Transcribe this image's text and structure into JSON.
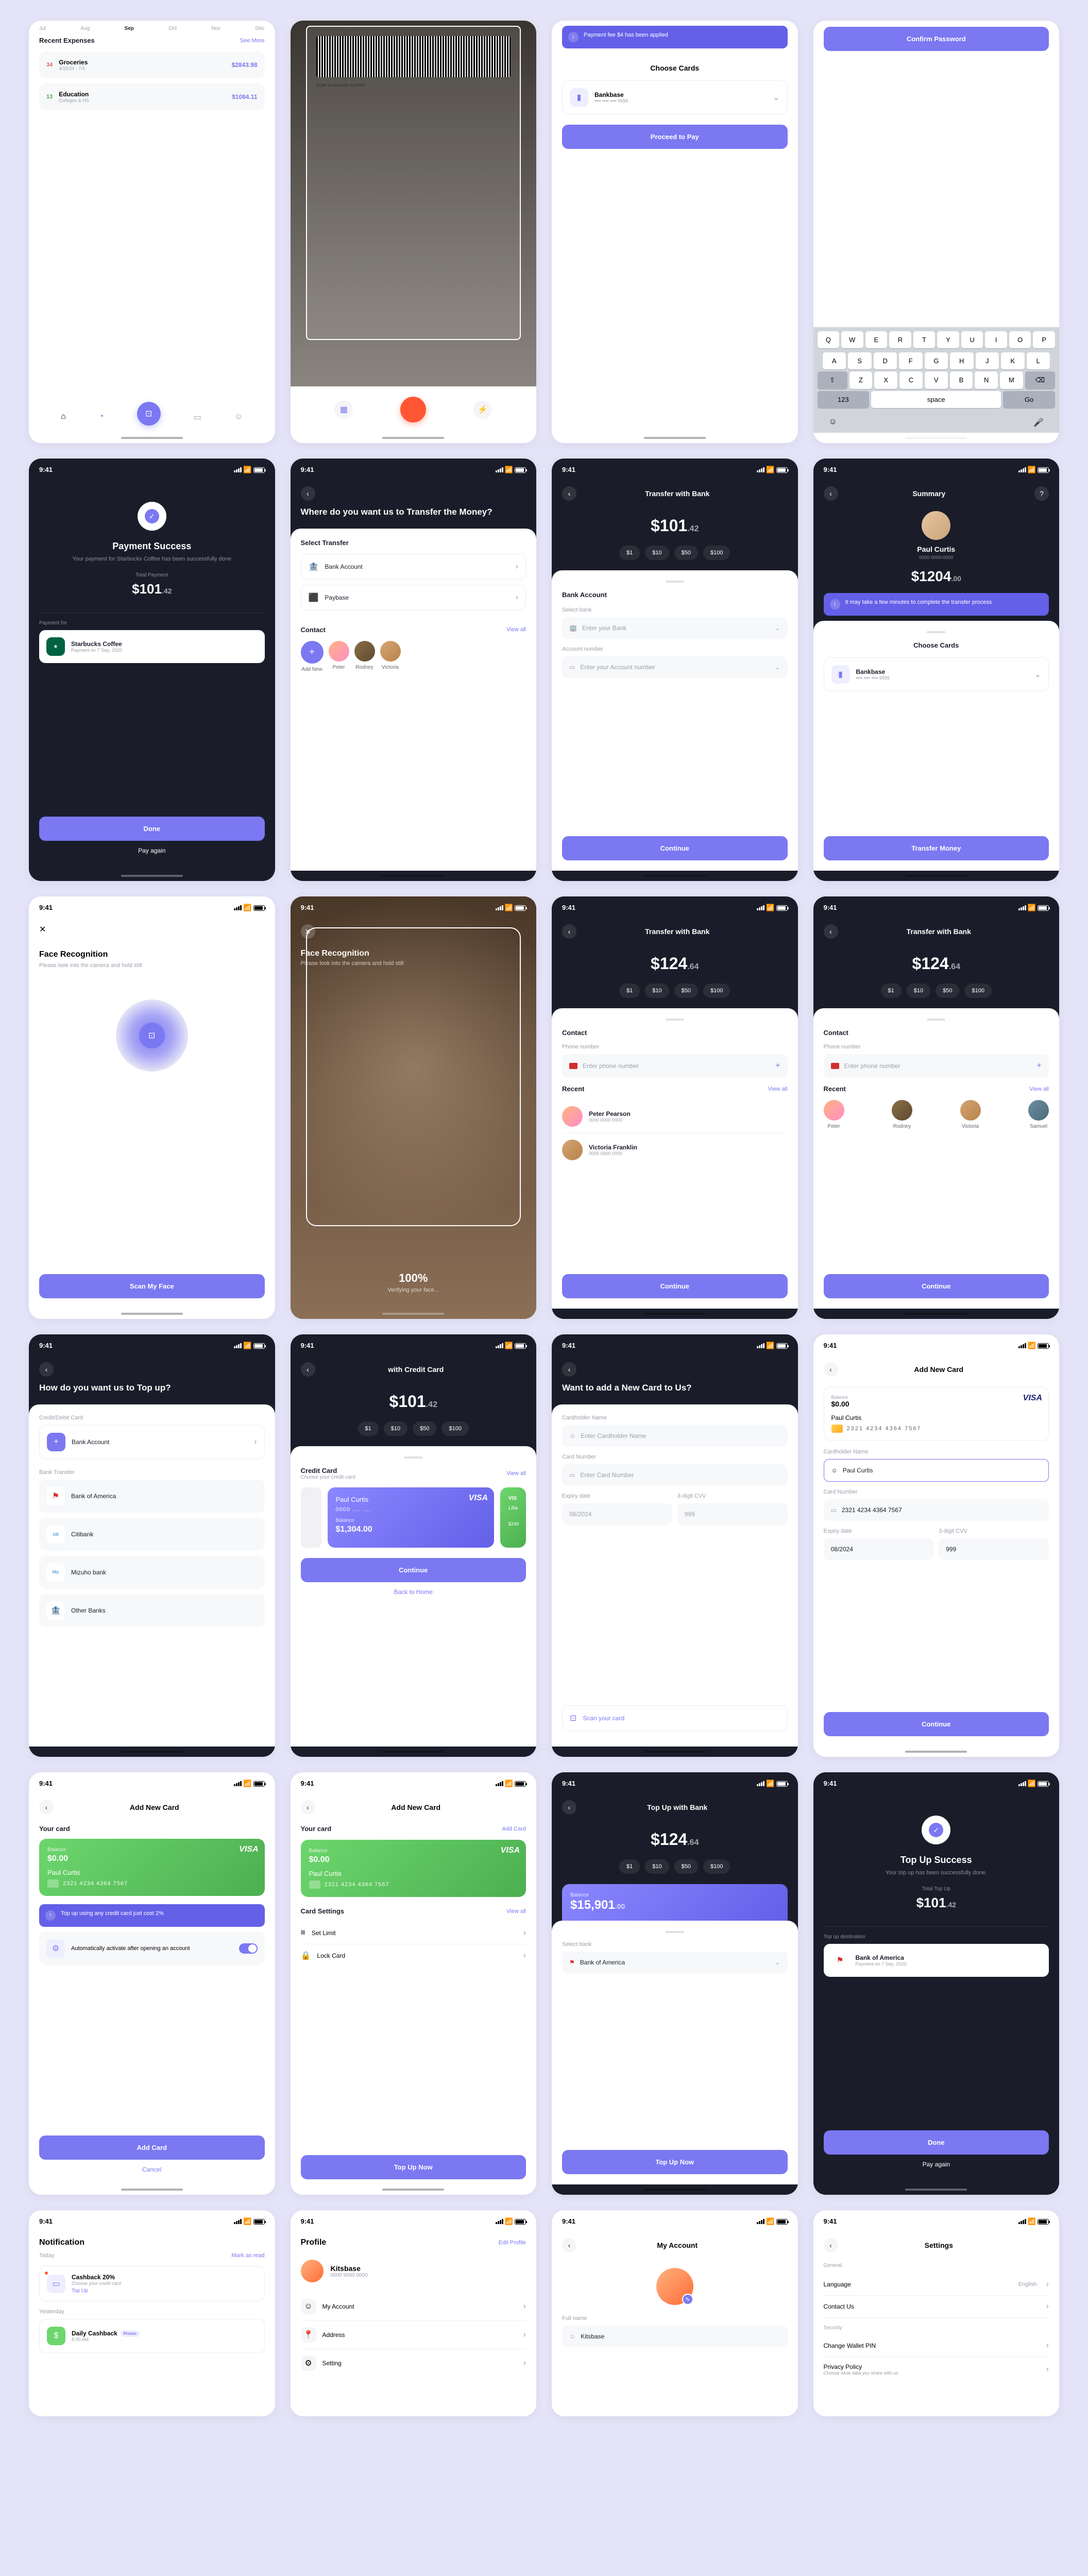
{
  "statusTime": "9:41",
  "r0": {
    "s1": {
      "months": [
        "Jul",
        "Aug",
        "Sep",
        "Oct",
        "Nov",
        "Dec"
      ],
      "section": "Recent Expenses",
      "link": "See More",
      "items": [
        {
          "day": "34",
          "name": "Groceries",
          "sub": "4/15/24 - 7/4",
          "amt": "$2843.98"
        },
        {
          "day": "13",
          "name": "Education",
          "sub": "Colleges & HS",
          "amt": "$1084.11"
        }
      ]
    },
    "s2": {
      "scanLabel": "Scan a barcode number"
    },
    "s3": {
      "notice": "Payment fee $4 has been applied",
      "title": "Choose Cards",
      "bank": "Bankbase",
      "bankNum": "•••• •••• •••• 9999",
      "btn": "Proceed to Pay"
    },
    "s4": {
      "btn": "Confirm Password",
      "keys1": [
        "Q",
        "W",
        "E",
        "R",
        "T",
        "Y",
        "U",
        "I",
        "O",
        "P"
      ],
      "keys2": [
        "A",
        "S",
        "D",
        "F",
        "G",
        "H",
        "J",
        "K",
        "L"
      ],
      "keys3": [
        "Z",
        "X",
        "C",
        "V",
        "B",
        "N",
        "M"
      ],
      "num": "123",
      "space": "space",
      "go": "Go"
    }
  },
  "r1": {
    "s1": {
      "title": "Payment Success",
      "sub": "Your payment for Starbucks Coffee has been successfully done",
      "tpLabel": "Total Payment",
      "amt": "$101",
      "amtDec": ".42",
      "pf": "Payment for",
      "merchant": "Starbucks Coffee",
      "merchSub": "Payment on 7 Sep, 2020",
      "done": "Done",
      "again": "Pay again"
    },
    "s2": {
      "title": "Where do you want us to Transfer the Money?",
      "sel": "Select Transfer",
      "opt1": "Bank Account",
      "opt2": "Paybase",
      "contactH": "Contact",
      "viewAll": "View all",
      "add": "Add New",
      "c1": "Peter",
      "c2": "Rodney",
      "c3": "Victoria"
    },
    "s3": {
      "title": "Transfer with Bank",
      "amt": "$101",
      "dec": ".42",
      "chips": [
        "$1",
        "$10",
        "$50",
        "$100"
      ],
      "sec": "Bank Account",
      "f1": "Select bank",
      "p1": "Enter your Bank",
      "f2": "Account number",
      "p2": "Enter your Account number",
      "btn": "Continue"
    },
    "s4": {
      "title": "Summary",
      "name": "Paul Curtis",
      "sub": "0000-0000-0000",
      "amt": "$1204",
      "dec": ".00",
      "notice": "It may take a few minutes to complete the transfer process",
      "choose": "Choose Cards",
      "bank": "Bankbase",
      "bankNum": "•••• •••• •••• 9999",
      "btn": "Transfer Money"
    }
  },
  "r2": {
    "s1": {
      "title": "Face Recognition",
      "sub": "Please look into the camera and hold still",
      "btn": "Scan My Face"
    },
    "s2": {
      "title": "Face Recognition",
      "sub": "Please look into the camera and hold still",
      "pct": "100%",
      "verifying": "Verifying your face..."
    },
    "s3": {
      "title": "Transfer with Bank",
      "amt": "$124",
      "dec": ".64",
      "chips": [
        "$1",
        "$10",
        "$50",
        "$100"
      ],
      "sec": "Contact",
      "f1": "Phone number",
      "p1": "Enter phone number",
      "recent": "Recent",
      "viewAll": "View all",
      "c1": "Peter Pearson",
      "c1s": "0000 0000 0000",
      "c2": "Victoria Franklin",
      "c2s": "0000 0000 0000",
      "btn": "Continue"
    },
    "s4": {
      "title": "Transfer with Bank",
      "amt": "$124",
      "dec": ".64",
      "chips": [
        "$1",
        "$10",
        "$50",
        "$100"
      ],
      "sec": "Contact",
      "f1": "Phone number",
      "p1": "Enter phone number",
      "recent": "Recent",
      "viewAll": "View all",
      "c1": "Peter",
      "c2": "Rodney",
      "c3": "Victoria",
      "c4": "Samuel",
      "btn": "Continue"
    }
  },
  "r3": {
    "s1": {
      "title": "How do you want us to Top up?",
      "cat1": "Credit/Debit Card",
      "opt1": "Bank Account",
      "cat2": "Bank Transfer",
      "b1": "Bank of America",
      "b2": "Citibank",
      "b3": "Mizuho bank",
      "b4": "Other Banks"
    },
    "s2": {
      "title": "with Credit Card",
      "amt": "$101",
      "dec": ".42",
      "chips": [
        "$1",
        "$10",
        "$50",
        "$100"
      ],
      "sec": "Credit Card",
      "sub": "Choose your credit card",
      "viewAll": "View all",
      "brand": "VISA",
      "name": "Paul Curtis",
      "num": "0000 .... ....",
      "bal": "Balance",
      "balAmt": "$1,304.00",
      "name2": "Lilia",
      "bal2": "$249",
      "btn": "Continue",
      "back": "Back to Home"
    },
    "s3": {
      "title": "Want to add a New Card to Us?",
      "f1": "Cardholder Name",
      "p1": "Enter Cardholder Name",
      "f2": "Card Number",
      "p2": "Enter Card Number",
      "f3": "Expiry date",
      "p3": "08/2024",
      "f4": "3-digit CVV",
      "p4": "999",
      "scan": "Scan your card"
    },
    "s4": {
      "title": "Add New Card",
      "bal": "Balance",
      "balAmt": "$0.00",
      "brand": "VISA",
      "name": "Paul Curtis",
      "num": "2321  4234  4364  7567",
      "f1": "Cardholder Name",
      "v1": "Paul Curtis",
      "f2": "Card Number",
      "v2": "2321 4234 4364 7567",
      "f3": "Expiry date",
      "v3": "08/2024",
      "f4": "3-digit CVV",
      "v4": "999",
      "btn": "Continue"
    }
  },
  "r4": {
    "s1": {
      "title": "Add New Card",
      "sec": "Your card",
      "bal": "Balance",
      "balAmt": "$0.00",
      "brand": "VISA",
      "name": "Paul Curtis",
      "num": "2321  4234  4364  7567",
      "tip": "Top up using any credit card just cost 2%",
      "auto": "Automatically activate after opening an account",
      "btn": "Add Card",
      "cancel": "Cancel"
    },
    "s2": {
      "title": "Add New Card",
      "sec": "Your card",
      "add": "Add Card",
      "bal": "Balance",
      "balAmt": "$0.00",
      "brand": "VISA",
      "name": "Paul Curtis",
      "num": "2321  4234  4364  7567",
      "settings": "Card Settings",
      "viewAll": "View all",
      "opt1": "Set Limit",
      "opt2": "Lock Card",
      "btn": "Top Up Now"
    },
    "s3": {
      "title": "Top Up with Bank",
      "amt": "$124",
      "dec": ".64",
      "chips": [
        "$1",
        "$10",
        "$50",
        "$100"
      ],
      "cbal": "Balance",
      "cbalAmt": "$15,901",
      "cbalDec": ".00",
      "sel": "Select bank",
      "bank": "Bank of America",
      "btn": "Top Up Now"
    },
    "s4": {
      "title": "Top Up Success",
      "sub": "Your top up has been successfully done.",
      "tpLabel": "Total Top Up",
      "amt": "$101",
      "dec": ".42",
      "dest": "Top up destination",
      "bank": "Bank of America",
      "bankSub": "Payment on 7 Sep, 2020",
      "done": "Done",
      "again": "Pay again"
    }
  },
  "r5": {
    "s1": {
      "title": "Notification",
      "today": "Today",
      "mark": "Mark as read",
      "n1": "Cashback 20%",
      "n1s": "Choose your credit card",
      "n1a": "Top Up",
      "yest": "Yesterday",
      "n2": "Daily Cashback",
      "n2s": "8:00 AM",
      "promo": "Promo"
    },
    "s2": {
      "title": "Profile",
      "edit": "Edit Profile",
      "name": "Kitsbase",
      "sub": "0000 9090 0000",
      "m1": "My Account",
      "m2": "Address",
      "m3": "Setting"
    },
    "s3": {
      "title": "My Account",
      "f1": "Full name",
      "v1": "Kitsbase"
    },
    "s4": {
      "title": "Settings",
      "g1": "General",
      "m1": "Language",
      "m1v": "English",
      "m2": "Contact Us",
      "g2": "Security",
      "m3": "Change Wallet PIN",
      "m4": "Privacy Policy",
      "m4s": "Choose what data you share with us"
    }
  }
}
